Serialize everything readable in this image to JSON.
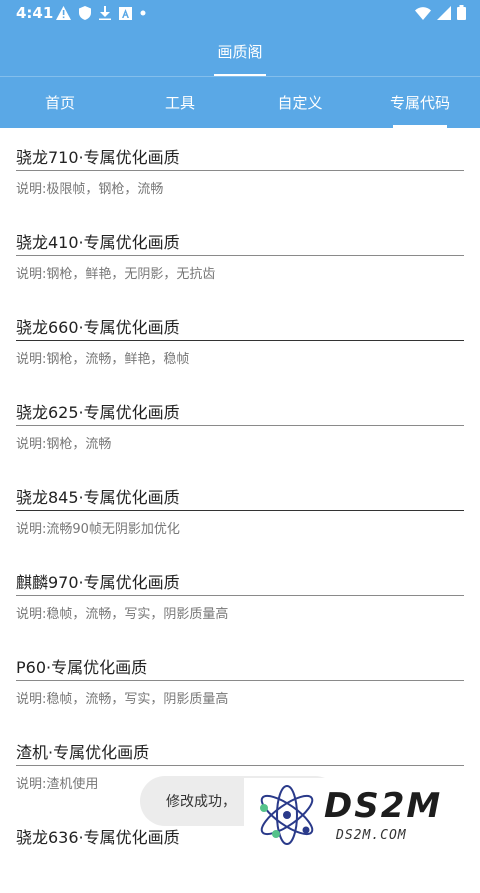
{
  "status_bar": {
    "time": "4:41",
    "icons": [
      "warning-icon",
      "shield-icon",
      "download-icon",
      "font-icon",
      "dot-icon"
    ],
    "right_icons": [
      "wifi-icon",
      "signal-icon",
      "battery-icon"
    ]
  },
  "app": {
    "title": "画质阁",
    "accent_color": "#5aa8e6"
  },
  "tabs": [
    {
      "label": "首页"
    },
    {
      "label": "工具"
    },
    {
      "label": "自定义"
    },
    {
      "label": "专属代码",
      "selected": true
    }
  ],
  "items": [
    {
      "title": "骁龙710·专属优化画质",
      "desc": "说明:极限帧，钢枪，流畅"
    },
    {
      "title": "骁龙410·专属优化画质",
      "desc": "说明:钢枪，鲜艳，无阴影，无抗齿"
    },
    {
      "title": "骁龙660·专属优化画质",
      "desc": "说明:钢枪，流畅，鲜艳，稳帧"
    },
    {
      "title": "骁龙625·专属优化画质",
      "desc": "说明:钢枪，流畅"
    },
    {
      "title": "骁龙845·专属优化画质",
      "desc": "说明:流畅90帧无阴影加优化"
    },
    {
      "title": "麒麟970·专属优化画质",
      "desc": "说明:稳帧，流畅，写实，阴影质量高"
    },
    {
      "title": "P60·专属优化画质",
      "desc": "说明:稳帧，流畅，写实，阴影质量高"
    },
    {
      "title": "渣机·专属优化画质",
      "desc": "说明:渣机使用"
    },
    {
      "title": "骁龙636·专属优化画质",
      "desc": ""
    }
  ],
  "toast": {
    "text": "修改成功，"
  },
  "watermark": {
    "brand": "DS2M",
    "url": "DS2M.COM"
  }
}
